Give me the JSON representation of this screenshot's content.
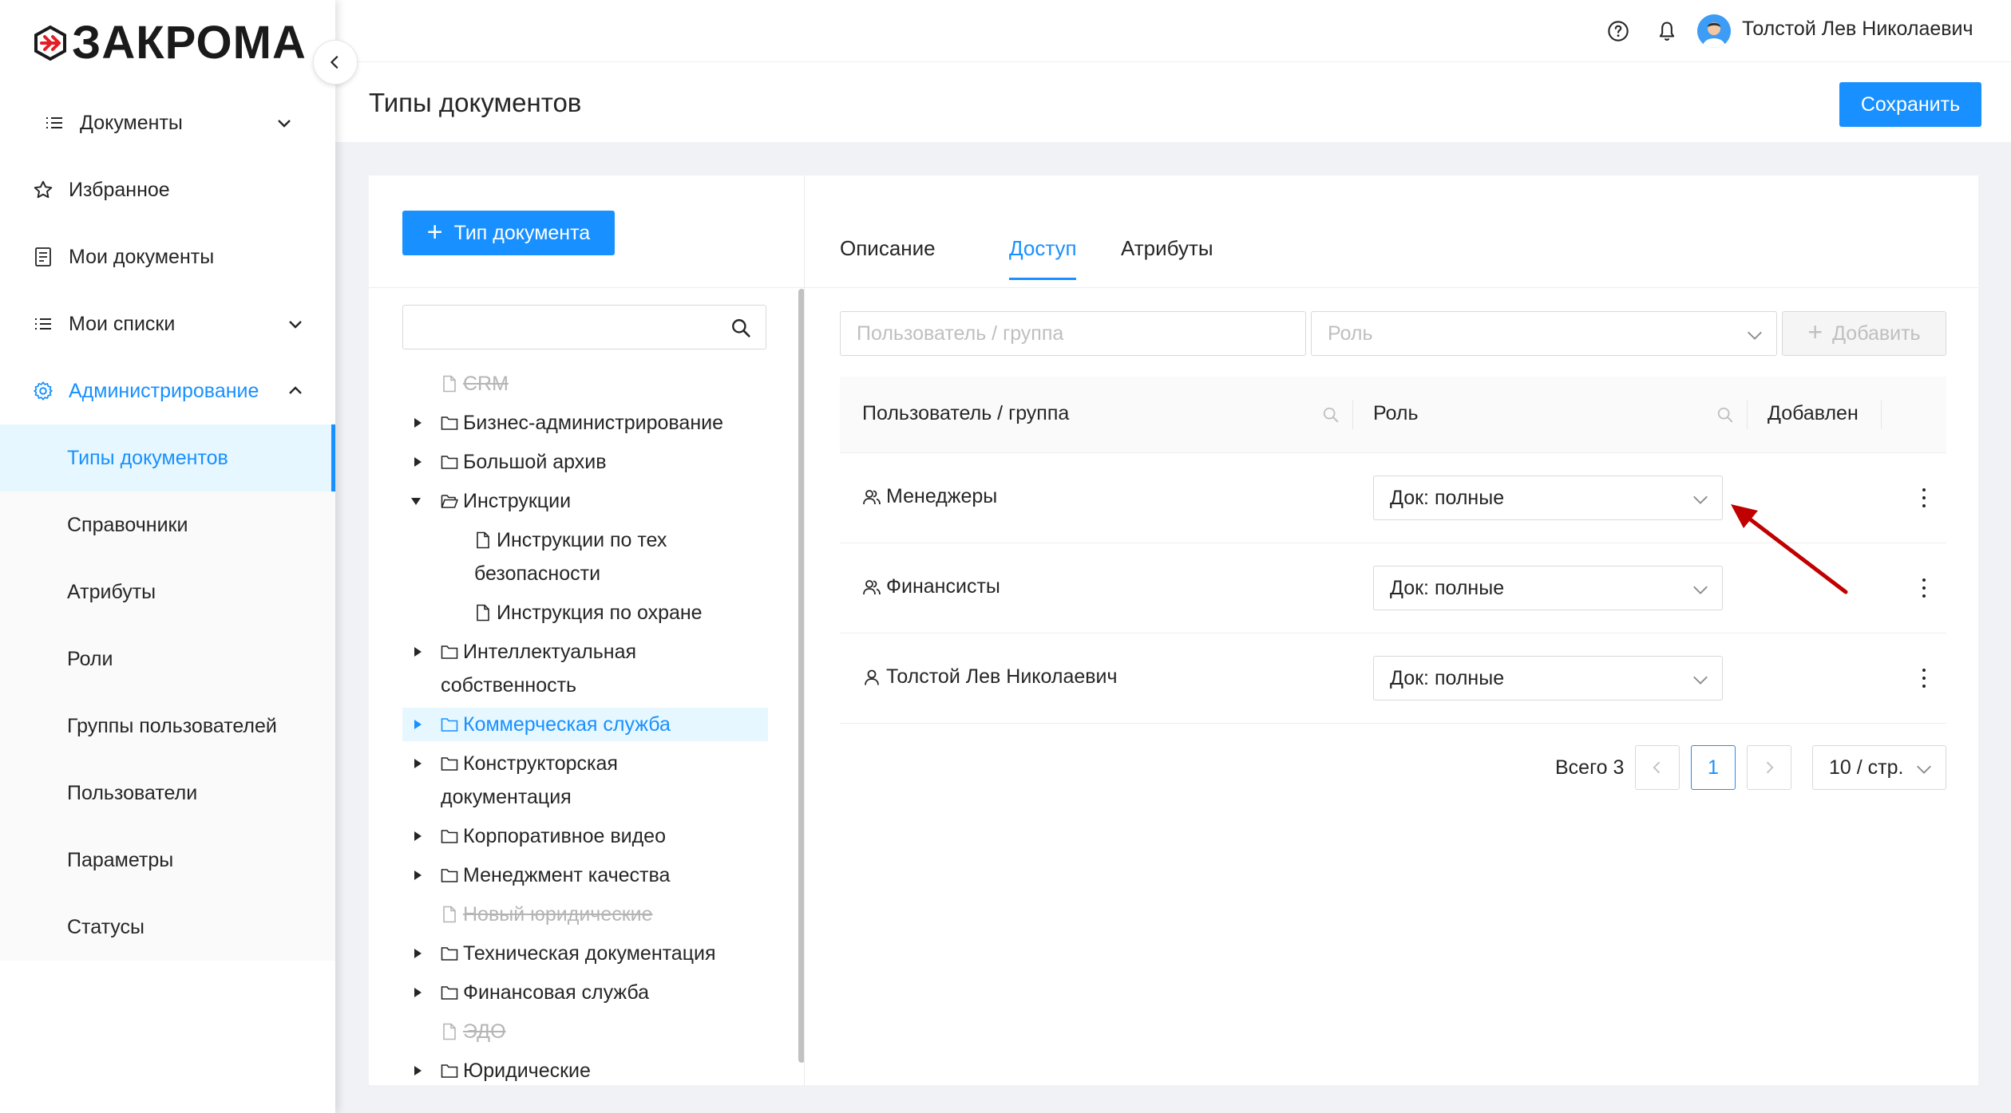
{
  "brand": {
    "name": "ЗАКРОМА",
    "accent": "#1890ff"
  },
  "header": {
    "user_name": "Толстой Лев Николаевич",
    "help_icon": "question-circle-icon",
    "notify_icon": "bell-icon"
  },
  "sidebar": {
    "items": [
      {
        "label": "Документы"
      },
      {
        "label": "Избранное"
      },
      {
        "label": "Мои документы"
      },
      {
        "label": "Мои списки"
      },
      {
        "label": "Администрирование"
      }
    ],
    "admin_items": [
      {
        "label": "Типы документов"
      },
      {
        "label": "Справочники"
      },
      {
        "label": "Атрибуты"
      },
      {
        "label": "Роли"
      },
      {
        "label": "Группы пользователей"
      },
      {
        "label": "Пользователи"
      },
      {
        "label": "Параметры"
      },
      {
        "label": "Статусы"
      }
    ]
  },
  "page": {
    "title": "Типы документов",
    "save_label": "Сохранить"
  },
  "tree": {
    "add_label": "Тип документа",
    "nodes": [
      {
        "label": "CRM"
      },
      {
        "label": "Бизнес-администрирование"
      },
      {
        "label": "Большой архив"
      },
      {
        "label": "Инструкции"
      },
      {
        "line1": "Инструкции по тех",
        "line2": "безопасности"
      },
      {
        "label": "Инструкция по охране"
      },
      {
        "line1": "Интеллектуальная",
        "line2": "собственность"
      },
      {
        "label": "Коммерческая служба"
      },
      {
        "line1": "Конструкторская",
        "line2": "документация"
      },
      {
        "label": "Корпоративное видео"
      },
      {
        "label": "Менеджмент качества"
      },
      {
        "label": "Новый юридические"
      },
      {
        "label": "Техническая документация"
      },
      {
        "label": "Финансовая служба"
      },
      {
        "label": "ЭДО"
      },
      {
        "label": "Юридические"
      }
    ]
  },
  "tabs": [
    {
      "label": "Описание"
    },
    {
      "label": "Доступ"
    },
    {
      "label": "Атрибуты"
    }
  ],
  "access": {
    "user_placeholder": "Пользователь / группа",
    "role_placeholder": "Роль",
    "add_label": "Добавить",
    "columns": {
      "user": "Пользователь / группа",
      "role": "Роль",
      "added": "Добавлен"
    },
    "rows": [
      {
        "name": "Менеджеры",
        "role": "Док: полные"
      },
      {
        "name": "Финансисты",
        "role": "Док: полные"
      },
      {
        "name": "Толстой Лев Николаевич",
        "role": "Док: полные"
      }
    ]
  },
  "pagination": {
    "total": "Всего 3",
    "current": "1",
    "page_size": "10 / стр."
  }
}
